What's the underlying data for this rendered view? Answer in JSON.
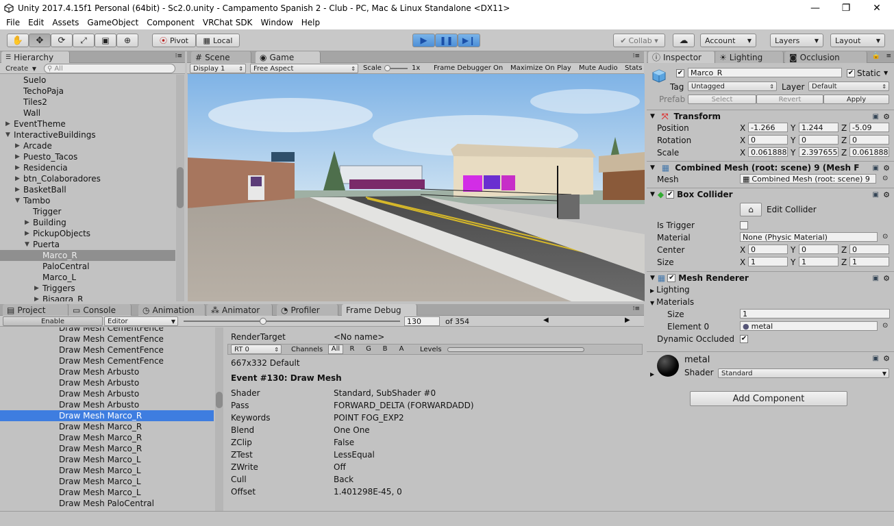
{
  "window": {
    "title": "Unity 2017.4.15f1 Personal (64bit) - Sc2.0.unity - Campamento Spanish 2 - Club - PC, Mac & Linux Standalone <DX11>",
    "minimize": "—",
    "maximize": "❐",
    "close": "✕"
  },
  "menu": [
    "File",
    "Edit",
    "Assets",
    "GameObject",
    "Component",
    "VRChat SDK",
    "Window",
    "Help"
  ],
  "toolbar": {
    "pivot": "Pivot",
    "local": "Local",
    "collab": "Collab ▾",
    "account": "Account",
    "layers": "Layers",
    "layout": "Layout"
  },
  "hierarchy": {
    "tab": "Hierarchy",
    "create": "Create",
    "search_placeholder": "All",
    "items": [
      {
        "label": "Suelo",
        "depth": 2,
        "arrow": ""
      },
      {
        "label": "TechoPaja",
        "depth": 2,
        "arrow": ""
      },
      {
        "label": "Tiles2",
        "depth": 2,
        "arrow": ""
      },
      {
        "label": "Wall",
        "depth": 2,
        "arrow": ""
      },
      {
        "label": "EventTheme",
        "depth": 1,
        "arrow": "▶"
      },
      {
        "label": "InteractiveBuildings",
        "depth": 1,
        "arrow": "▼"
      },
      {
        "label": "Arcade",
        "depth": 2,
        "arrow": "▶"
      },
      {
        "label": "Puesto_Tacos",
        "depth": 2,
        "arrow": "▶"
      },
      {
        "label": "Residencia",
        "depth": 2,
        "arrow": "▶"
      },
      {
        "label": "btn_Colaboradores",
        "depth": 2,
        "arrow": "▶"
      },
      {
        "label": "BasketBall",
        "depth": 2,
        "arrow": "▶"
      },
      {
        "label": "Tambo",
        "depth": 2,
        "arrow": "▼"
      },
      {
        "label": "Trigger",
        "depth": 3,
        "arrow": ""
      },
      {
        "label": "Building",
        "depth": 3,
        "arrow": "▶"
      },
      {
        "label": "PickupObjects",
        "depth": 3,
        "arrow": "▶"
      },
      {
        "label": "Puerta",
        "depth": 3,
        "arrow": "▼"
      },
      {
        "label": "Marco_R",
        "depth": 4,
        "arrow": ""
      },
      {
        "label": "PaloCentral",
        "depth": 4,
        "arrow": ""
      },
      {
        "label": "Marco_L",
        "depth": 4,
        "arrow": ""
      },
      {
        "label": "Triggers",
        "depth": 4,
        "arrow": "▶"
      },
      {
        "label": "Bisagra_R",
        "depth": 4,
        "arrow": "▶"
      }
    ]
  },
  "center_tabs": {
    "scene": "Scene",
    "game": "Game"
  },
  "game_bar": {
    "display": "Display 1",
    "aspect": "Free Aspect",
    "scale_label": "Scale",
    "scale_value": "1x",
    "frame_debugger": "Frame Debugger On",
    "maximize": "Maximize On Play",
    "mute": "Mute Audio",
    "stats": "Stats"
  },
  "bottom_tabs": [
    "Project",
    "Console",
    "Animation",
    "Animator",
    "Profiler",
    "Frame Debug"
  ],
  "frame_debug": {
    "enable": "Enable",
    "editor": "Editor",
    "frame": "130",
    "of": "of 354",
    "events": [
      "Draw Mesh CementFence",
      "Draw Mesh CementFence",
      "Draw Mesh CementFence",
      "Draw Mesh CementFence",
      "Draw Mesh Arbusto",
      "Draw Mesh Arbusto",
      "Draw Mesh Arbusto",
      "Draw Mesh Arbusto",
      "Draw Mesh Marco_R",
      "Draw Mesh Marco_R",
      "Draw Mesh Marco_R",
      "Draw Mesh Marco_R",
      "Draw Mesh Marco_L",
      "Draw Mesh Marco_L",
      "Draw Mesh Marco_L",
      "Draw Mesh Marco_L",
      "Draw Mesh PaloCentral"
    ],
    "render_target_label": "RenderTarget",
    "render_target_value": "<No name>",
    "rt": "RT 0",
    "channels": "Channels",
    "channel_buttons": [
      "All",
      "R",
      "G",
      "B",
      "A"
    ],
    "levels": "Levels",
    "resolution": "667x332 Default",
    "event_title": "Event #130: Draw Mesh",
    "props": [
      {
        "k": "Shader",
        "v": "Standard, SubShader #0"
      },
      {
        "k": "Pass",
        "v": "FORWARD_DELTA (FORWARDADD)"
      },
      {
        "k": "Keywords",
        "v": "POINT FOG_EXP2"
      },
      {
        "k": "Blend",
        "v": "One One"
      },
      {
        "k": "ZClip",
        "v": "False"
      },
      {
        "k": "ZTest",
        "v": "LessEqual"
      },
      {
        "k": "ZWrite",
        "v": "Off"
      },
      {
        "k": "Cull",
        "v": "Back"
      },
      {
        "k": "Offset",
        "v": "1.401298E-45, 0"
      }
    ]
  },
  "inspector": {
    "tabs": [
      "Inspector",
      "Lighting",
      "Occlusion"
    ],
    "name": "Marco_R",
    "static": "Static",
    "tag_label": "Tag",
    "tag": "Untagged",
    "layer_label": "Layer",
    "layer": "Default",
    "prefab": "Prefab",
    "select": "Select",
    "revert": "Revert",
    "apply": "Apply",
    "transform": {
      "title": "Transform",
      "rows": [
        {
          "label": "Position",
          "x": "-1.266",
          "y": "1.244",
          "z": "-5.09"
        },
        {
          "label": "Rotation",
          "x": "0",
          "y": "0",
          "z": "0"
        },
        {
          "label": "Scale",
          "x": "0.061888",
          "y": "2.397655",
          "z": "0.061888"
        }
      ]
    },
    "mesh_filter": {
      "title": "Combined Mesh (root: scene) 9 (Mesh F",
      "mesh_label": "Mesh",
      "mesh_value": "Combined Mesh (root: scene) 9"
    },
    "box_collider": {
      "title": "Box Collider",
      "edit": "Edit Collider",
      "is_trigger": "Is Trigger",
      "material_label": "Material",
      "material_value": "None (Physic Material)",
      "center_label": "Center",
      "center": {
        "x": "0",
        "y": "0",
        "z": "0"
      },
      "size_label": "Size",
      "size": {
        "x": "1",
        "y": "1",
        "z": "1"
      }
    },
    "mesh_renderer": {
      "title": "Mesh Renderer",
      "lighting": "Lighting",
      "materials": "Materials",
      "size_label": "Size",
      "size_value": "1",
      "element_label": "Element 0",
      "element_value": "metal",
      "dynamic": "Dynamic Occluded"
    },
    "material": {
      "name": "metal",
      "shader_label": "Shader",
      "shader_value": "Standard"
    },
    "add_component": "Add Component"
  },
  "axis": {
    "x": "X",
    "y": "Y",
    "z": "Z"
  },
  "colors": {
    "selection": "#3e7de0",
    "play_blue": "#4d8fd6"
  }
}
